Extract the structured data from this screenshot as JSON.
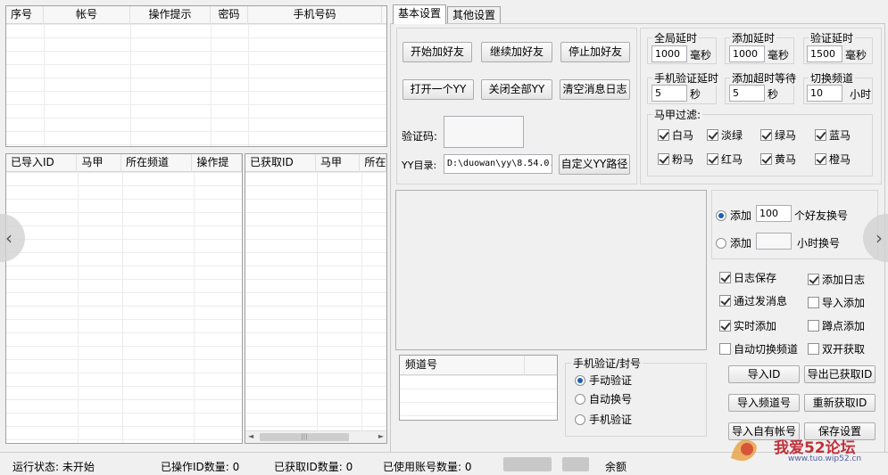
{
  "top_grid": {
    "columns": [
      "序号",
      "帐号",
      "操作提示",
      "密码",
      "手机号码"
    ]
  },
  "imported_grid": {
    "columns": [
      "已导入ID",
      "马甲",
      "所在频道",
      "操作提"
    ]
  },
  "fetched_grid": {
    "columns": [
      "已获取ID",
      "马甲",
      "所在"
    ]
  },
  "tabs": [
    "基本设置",
    "其他设置"
  ],
  "buttons": {
    "start_add": "开始加好友",
    "continue_add": "继续加好友",
    "stop_add": "停止加好友",
    "open_yy": "打开一个YY",
    "close_all_yy": "关闭全部YY",
    "clear_log": "清空消息日志",
    "custom_path": "自定义YY路径",
    "import_id": "导入ID",
    "export_fetched": "导出已获取ID",
    "import_channel": "导入频道号",
    "refetch_id": "重新获取ID",
    "import_account": "导入自有帐号",
    "save_settings": "保存设置"
  },
  "captcha": {
    "label": "验证码:"
  },
  "yy_dir": {
    "label": "YY目录:",
    "value": "D:\\duowan\\yy\\8.54.0."
  },
  "delays": {
    "global": {
      "label": "全局延时",
      "value": "1000",
      "unit": "毫秒"
    },
    "add": {
      "label": "添加延时",
      "value": "1000",
      "unit": "毫秒"
    },
    "verify": {
      "label": "验证延时",
      "value": "1500",
      "unit": "毫秒"
    },
    "phone_verify": {
      "label": "手机验证延时",
      "value": "5",
      "unit": "秒"
    },
    "add_timeout": {
      "label": "添加超时等待",
      "value": "5",
      "unit": "秒"
    },
    "switch_channel": {
      "label": "切换频道",
      "value": "10",
      "unit": "小时"
    }
  },
  "vest_filter": {
    "label": "马甲过滤:",
    "items": [
      "白马",
      "淡绿",
      "绿马",
      "蓝马",
      "粉马",
      "红马",
      "黄马",
      "橙马"
    ]
  },
  "switch_account": {
    "opt1_prefix": "添加",
    "opt1_value": "100",
    "opt1_suffix": "个好友换号",
    "opt2_prefix": "添加",
    "opt2_value": "",
    "opt2_suffix": "小时换号"
  },
  "options": {
    "log_save": "日志保存",
    "add_log": "添加日志",
    "pass_msg": "通过发消息",
    "import_add": "导入添加",
    "realtime_add": "实时添加",
    "squat_add": "蹲点添加",
    "auto_switch": "自动切换频道",
    "dual_fetch": "双开获取"
  },
  "channel_list": {
    "header": "频道号"
  },
  "phone_verify_group": {
    "label": "手机验证/封号",
    "options": [
      "手动验证",
      "自动换号",
      "手机验证"
    ]
  },
  "status_bar": {
    "run_state": "运行状态: 未开始",
    "ops_count": "已操作ID数量:  0",
    "fetched_count": "已获取ID数量:  0",
    "used_accounts": "已使用账号数量:  0",
    "balance": "余额"
  },
  "watermark": {
    "text": "我爱52论坛",
    "url": "www.tuo.wip52.cn"
  }
}
